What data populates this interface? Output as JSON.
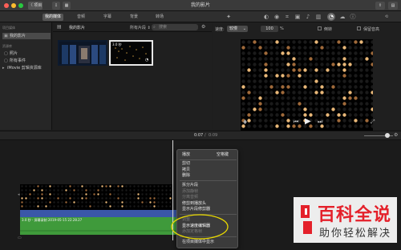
{
  "window": {
    "title": "我的影片"
  },
  "titlebar": {
    "back_label": "〈 项目",
    "share_label": "⇪"
  },
  "toolbar": {
    "tabs": [
      {
        "label": "我的媒体",
        "active": true
      },
      {
        "label": "音频",
        "active": false
      },
      {
        "label": "字幕",
        "active": false
      },
      {
        "label": "背景",
        "active": false
      },
      {
        "label": "转场",
        "active": false
      }
    ]
  },
  "sidebar": {
    "library_header": "项目媒体",
    "project_item": "我的影片",
    "resources_header": "资源库",
    "items": [
      {
        "label": "照片",
        "icon": "photos-icon"
      },
      {
        "label": "所有事件",
        "icon": "events-icon"
      },
      {
        "label": "iMovie 剪辑资源库",
        "icon": "library-icon"
      }
    ]
  },
  "browser": {
    "title": "我的影片",
    "filter_label": "所有片段 ⇕",
    "search_placeholder": "搜索",
    "clip2_duration": "3.0 秒"
  },
  "viewer": {
    "speed_label": "速度:",
    "speed_value": "较慢",
    "speed_percent": "100",
    "percent_sign": "%",
    "reverse_label": "倒转",
    "preserve_pitch_label": "保留音高"
  },
  "timebar": {
    "current": "0:07",
    "separator": "/",
    "total": "0:09"
  },
  "timeline": {
    "audio_clip_label": "3.0 秒 - 屏幕录制 2019-05-15 22.28.27"
  },
  "context_menu": {
    "items": [
      {
        "label": "播放",
        "shortcut": "空格键",
        "enabled": true
      },
      {
        "sep": true
      },
      {
        "label": "剪切",
        "enabled": true
      },
      {
        "label": "拷贝",
        "enabled": true
      },
      {
        "label": "删除",
        "enabled": true
      },
      {
        "sep": true
      },
      {
        "label": "拆分片段",
        "enabled": true
      },
      {
        "label": "添加静帧",
        "enabled": false
      },
      {
        "label": "分离音频",
        "enabled": false
      },
      {
        "label": "修剪到播放头",
        "enabled": true
      },
      {
        "label": "显示片段修剪器",
        "enabled": true
      },
      {
        "sep": true
      },
      {
        "label": "调整",
        "enabled": false
      },
      {
        "label": "显示速度编辑器",
        "enabled": true,
        "highlighted": true
      },
      {
        "label": "添加定格帧",
        "enabled": false
      },
      {
        "sep": true
      },
      {
        "label": "在项目媒体中显示",
        "enabled": true
      }
    ]
  },
  "watermark": {
    "title": "百科全说",
    "subtitle": "助你轻松解决"
  },
  "colors": {
    "green_clip": "#3f9a3b",
    "blue_audio": "#3a57a8",
    "highlight_circle": "#e8d800",
    "watermark_title": "#e4202a",
    "watermark_subtitle": "#333333"
  }
}
